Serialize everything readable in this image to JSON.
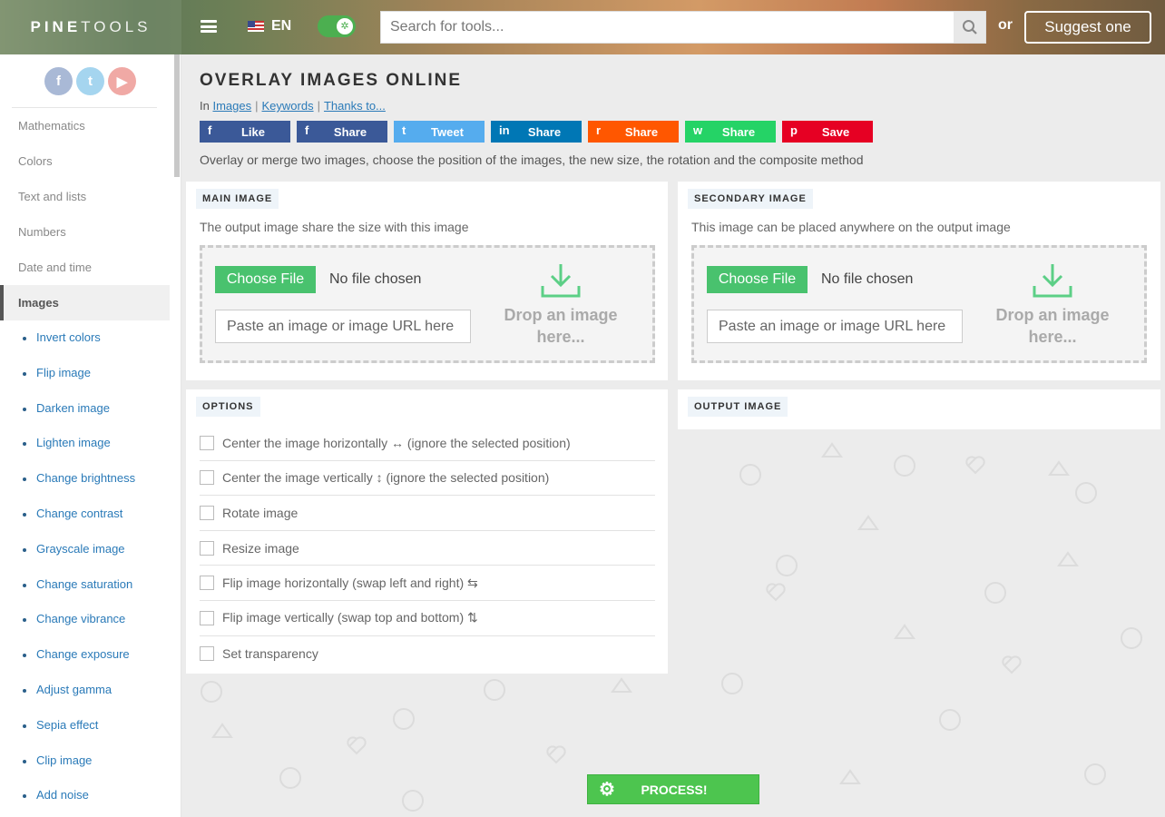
{
  "header": {
    "logo_bold": "PINE",
    "logo_light": "TOOLS",
    "language": "EN",
    "search_placeholder": "Search for tools...",
    "or_text": "or",
    "suggest_label": "Suggest one"
  },
  "sidebar": {
    "social": [
      "f",
      "t",
      "y"
    ],
    "categories": [
      "Mathematics",
      "Colors",
      "Text and lists",
      "Numbers",
      "Date and time",
      "Images"
    ],
    "active_category": "Images",
    "items": [
      "Invert colors",
      "Flip image",
      "Darken image",
      "Lighten image",
      "Change brightness",
      "Change contrast",
      "Grayscale image",
      "Change saturation",
      "Change vibrance",
      "Change exposure",
      "Adjust gamma",
      "Sepia effect",
      "Clip image",
      "Add noise"
    ]
  },
  "page": {
    "title": "OVERLAY IMAGES ONLINE",
    "breadcrumb_prefix": "In",
    "breadcrumb_links": [
      "Images",
      "Keywords",
      "Thanks to..."
    ],
    "description": "Overlay or merge two images, choose the position of the images, the new size, the rotation and the composite method"
  },
  "share_buttons": [
    {
      "icon": "f",
      "label": "Like",
      "color": "#3b5998"
    },
    {
      "icon": "f",
      "label": "Share",
      "color": "#3b5998"
    },
    {
      "icon": "t",
      "label": "Tweet",
      "color": "#55acee"
    },
    {
      "icon": "in",
      "label": "Share",
      "color": "#0077b5"
    },
    {
      "icon": "r",
      "label": "Share",
      "color": "#ff5700"
    },
    {
      "icon": "w",
      "label": "Share",
      "color": "#25d366"
    },
    {
      "icon": "p",
      "label": "Save",
      "color": "#e60023"
    }
  ],
  "main_image": {
    "tag": "MAIN IMAGE",
    "subtitle": "The output image share the size with this image",
    "choose_label": "Choose File",
    "no_file": "No file chosen",
    "paste_placeholder": "Paste an image or image URL here",
    "drop_text": "Drop an image here..."
  },
  "secondary_image": {
    "tag": "SECONDARY IMAGE",
    "subtitle": "This image can be placed anywhere on the output image",
    "choose_label": "Choose File",
    "no_file": "No file chosen",
    "paste_placeholder": "Paste an image or image URL here",
    "drop_text": "Drop an image here..."
  },
  "options": {
    "tag": "OPTIONS",
    "items": [
      "Center the image horizontally ↔ (ignore the selected position)",
      "Center the image vertically ↕ (ignore the selected position)",
      "Rotate image",
      "Resize image",
      "Flip image horizontally (swap left and right) ⇆",
      "Flip image vertically (swap top and bottom) ⇅",
      "Set transparency"
    ]
  },
  "output": {
    "tag": "OUTPUT IMAGE"
  },
  "process_label": "PROCESS!"
}
